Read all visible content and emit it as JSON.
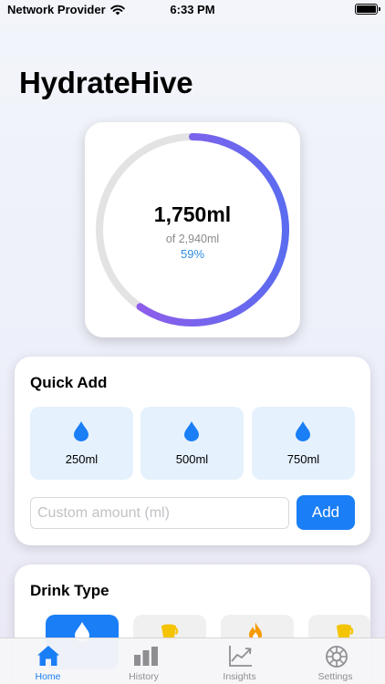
{
  "status_bar": {
    "carrier": "Network Provider",
    "time": "6:33 PM"
  },
  "app": {
    "title": "HydrateHive"
  },
  "progress": {
    "amount": "1,750ml",
    "goal_text": "of 2,940ml",
    "percent_text": "59%",
    "fraction": 0.595
  },
  "colors": {
    "accent": "#1a7ef6",
    "ring_start": "#9b59e8",
    "ring_end": "#5b6cf0",
    "ring_track": "#e3e3e3",
    "quick_button_bg": "#e5f1fc"
  },
  "quick_add": {
    "title": "Quick Add",
    "buttons": [
      {
        "label": "250ml",
        "icon": "water-drop-icon"
      },
      {
        "label": "500ml",
        "icon": "water-drop-icon"
      },
      {
        "label": "750ml",
        "icon": "water-drop-icon"
      }
    ],
    "custom_placeholder": "Custom amount (ml)",
    "custom_value": "",
    "add_label": "Add"
  },
  "drink_type": {
    "title": "Drink Type",
    "options": [
      {
        "icon": "water-drop-icon",
        "selected": true
      },
      {
        "icon": "coffee-cup-icon",
        "selected": false
      },
      {
        "icon": "flame-icon",
        "selected": false
      },
      {
        "icon": "coffee-cup-icon",
        "selected": false
      }
    ]
  },
  "tabs": [
    {
      "label": "Home",
      "icon": "house-icon",
      "active": true
    },
    {
      "label": "History",
      "icon": "bar-chart-icon",
      "active": false
    },
    {
      "label": "Insights",
      "icon": "line-chart-icon",
      "active": false
    },
    {
      "label": "Settings",
      "icon": "gear-icon",
      "active": false
    }
  ]
}
